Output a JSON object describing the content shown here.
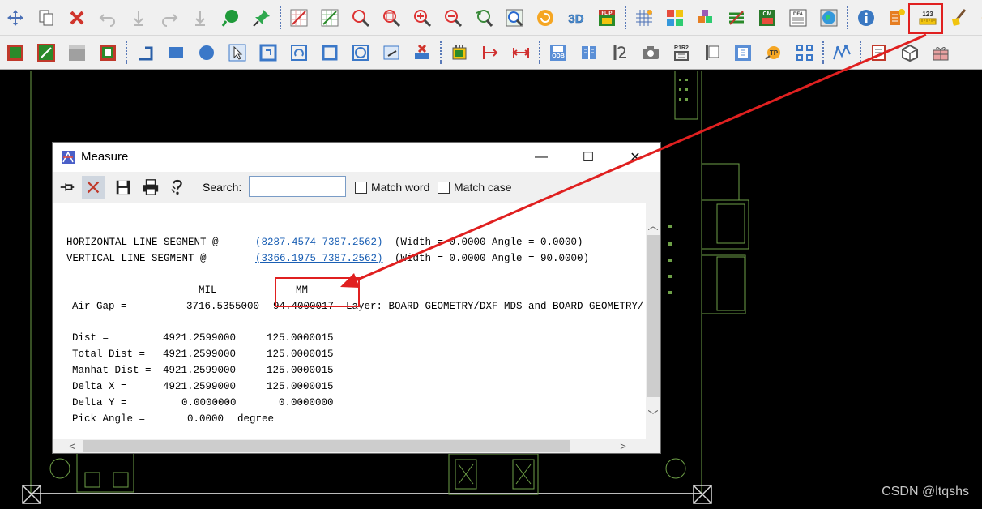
{
  "toolbar1": {
    "icons": [
      "move-icon",
      "copy-icon",
      "delete-icon",
      "undo-icon",
      "undo-down-icon",
      "redo-icon",
      "redo-down-icon",
      "green-ball-icon",
      "pin-icon",
      "zoom-grid-icon",
      "zoom-grid-green-icon",
      "zoom-fit-icon",
      "zoom-window-icon",
      "zoom-in-icon",
      "zoom-out-icon",
      "zoom-previous-icon",
      "zoom-world-icon",
      "redraw-icon",
      "3d-view-icon",
      "flip-design-icon",
      "grid-icon",
      "color-icon",
      "layer-visibility-icon",
      "unrats-icon",
      "cm-icon",
      "dfa-icon",
      "globe-icon",
      "info-icon",
      "show-element-icon",
      "measure-icon",
      "clean-icon",
      "star-icon"
    ],
    "label_3d": "3D",
    "label_flip": "FLIP",
    "label_cm": "CM",
    "label_dfa": "DFA",
    "label_measure": "123"
  },
  "toolbar2": {
    "icons": [
      "shape-fill-icon",
      "shape-void-icon",
      "shape-gray-icon",
      "shape-merge-icon",
      "add-line-icon",
      "rectangle-icon",
      "circle-icon",
      "select-arrow-icon",
      "frame-icon",
      "arc-icon",
      "square-icon",
      "round-rect-icon",
      "shape-edit-icon",
      "delete-shape-icon",
      "component-icon",
      "dimension-icon",
      "dimension-h-icon",
      "odb-icon",
      "book-icon",
      "pin-tool-icon",
      "camera-icon",
      "r1r2-icon",
      "flag-icon",
      "chip-icon",
      "tp-icon",
      "grid-dots-icon",
      "wave-icon",
      "doc-icon",
      "box-icon",
      "gift-icon"
    ],
    "label_odb": "ODB",
    "label_r1r2": "R1R2",
    "label_tp": "TP"
  },
  "dialog": {
    "title": "Measure",
    "minimize": "—",
    "maximize": "☐",
    "close": "✕",
    "search_label": "Search:",
    "search_value": "",
    "match_word": "Match word",
    "match_case": "Match case",
    "report": {
      "hseg_label": "HORIZONTAL LINE SEGMENT @",
      "hseg_link": "(8287.4574 7387.2562)",
      "hseg_info": "(Width = 0.0000 Angle = 0.0000)",
      "vseg_label": "VERTICAL LINE SEGMENT @",
      "vseg_link": "(3366.1975 7387.2562)",
      "vseg_info": "(Width = 0.0000 Angle = 90.0000)",
      "col_mil": "MIL",
      "col_mm": "MM",
      "rows": [
        {
          "label": "Air Gap =",
          "mil": "3716.5355000",
          "mm": "94.4000017",
          "extra": "Layer: BOARD GEOMETRY/DXF_MDS and BOARD GEOMETRY/"
        },
        {
          "label": "Dist =",
          "mil": "4921.2599000",
          "mm": "125.0000015",
          "extra": ""
        },
        {
          "label": "Total Dist =",
          "mil": "4921.2599000",
          "mm": "125.0000015",
          "extra": ""
        },
        {
          "label": "Manhat Dist =",
          "mil": "4921.2599000",
          "mm": "125.0000015",
          "extra": ""
        },
        {
          "label": "Delta X =",
          "mil": "4921.2599000",
          "mm": "125.0000015",
          "extra": ""
        },
        {
          "label": "Delta Y =",
          "mil": "0.0000000",
          "mm": "0.0000000",
          "extra": ""
        }
      ],
      "pick_angle_label": "Pick Angle =",
      "pick_angle_value": "0.0000",
      "pick_angle_unit": "degree"
    }
  },
  "watermark": "CSDN @ltqshs",
  "colors": {
    "annotation_red": "#e02020",
    "pcb_outline": "#6ea047",
    "link_blue": "#1a5fb4"
  }
}
